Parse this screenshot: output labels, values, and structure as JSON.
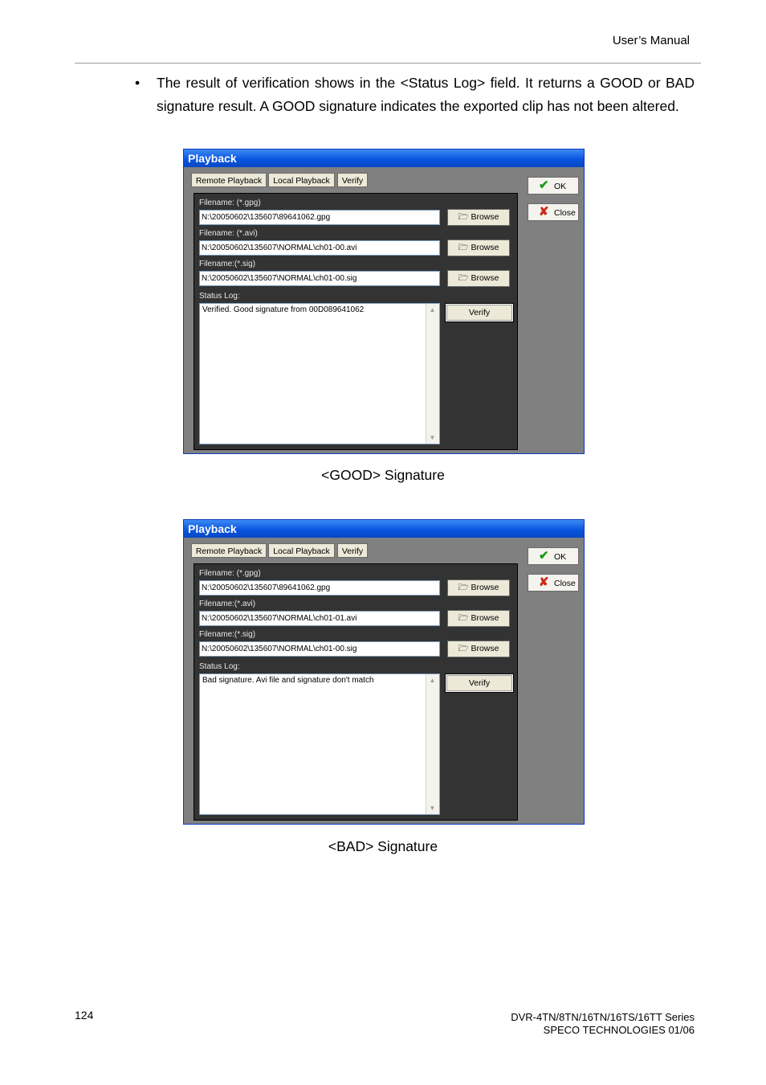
{
  "header": {
    "text": "User’s  Manual"
  },
  "bullet": {
    "symbol": "•",
    "text": "The result of verification shows in the <Status Log> field. It returns a GOOD or BAD signature result. A GOOD signature indicates the exported clip has not been altered."
  },
  "dialogs": [
    {
      "title": "Playback",
      "tabs": [
        "Remote Playback",
        "Local Playback",
        "Verify"
      ],
      "ok_label": "OK",
      "close_label": "Close",
      "fields": [
        {
          "label": "Filename: (*.gpg)",
          "value": "N:\\20050602\\135607\\89641062.gpg"
        },
        {
          "label": "Filename: (*.avi)",
          "value": "N:\\20050602\\135607\\NORMAL\\ch01-00.avi"
        },
        {
          "label": "Filename:(*.sig)",
          "value": "N:\\20050602\\135607\\NORMAL\\ch01-00.sig"
        }
      ],
      "browse_label": "Browse",
      "status_label": "Status Log:",
      "status_text": "Verified. Good signature from 00D089641062",
      "verify_label": "Verify",
      "caption": "<GOOD> Signature"
    },
    {
      "title": "Playback",
      "tabs": [
        "Remote Playback",
        "Local Playback",
        "Verify"
      ],
      "ok_label": "OK",
      "close_label": "Close",
      "fields": [
        {
          "label": "Filename: (*.gpg)",
          "value": "N:\\20050602\\135607\\89641062.gpg"
        },
        {
          "label": "Filename:(*.avi)",
          "value": "N:\\20050602\\135607\\NORMAL\\ch01-01.avi"
        },
        {
          "label": "Filename:(*.sig)",
          "value": "N:\\20050602\\135607\\NORMAL\\ch01-00.sig"
        }
      ],
      "browse_label": "Browse",
      "status_label": "Status Log:",
      "status_text": "Bad signature. Avi file and signature don't match",
      "verify_label": "Verify",
      "caption": "<BAD> Signature"
    }
  ],
  "footer": {
    "page_number": "124",
    "series": "DVR-4TN/8TN/16TN/16TS/16TT Series",
    "company": "SPECO TECHNOLOGIES 01/06"
  },
  "icons": {
    "ok": "check-icon",
    "close": "x-icon",
    "browse": "folder-open-icon",
    "scroll_up": "scroll-up-icon",
    "scroll_down": "scroll-down-icon"
  },
  "colors": {
    "title_bar": "#0a55e0",
    "dialog_bg": "#808080",
    "panel_bg": "#333333",
    "ok_icon": "#1a9a1a",
    "close_icon": "#cc2a1a"
  }
}
